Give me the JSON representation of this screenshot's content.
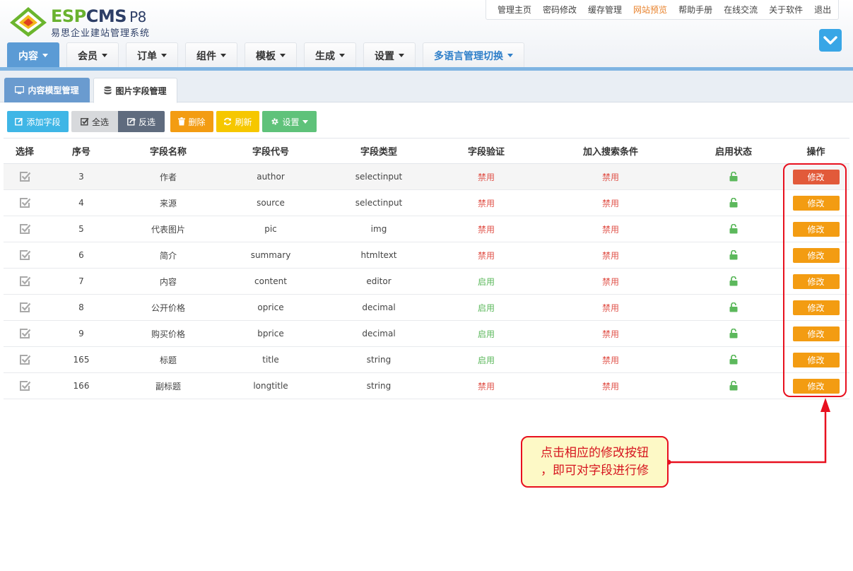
{
  "logo": {
    "brand_part1": "ESP",
    "brand_part2": "CMS",
    "version": "P8",
    "subtitle": "易思企业建站管理系统"
  },
  "toplinks": [
    "管理主页",
    "密码修改",
    "缓存管理",
    "网站预览",
    "帮助手册",
    "在线交流",
    "关于软件",
    "退出"
  ],
  "nav": [
    {
      "label": "内容",
      "active": true
    },
    {
      "label": "会员"
    },
    {
      "label": "订单"
    },
    {
      "label": "组件"
    },
    {
      "label": "模板"
    },
    {
      "label": "生成"
    },
    {
      "label": "设置"
    },
    {
      "label": "多语言管理切换"
    }
  ],
  "subtabs": {
    "model": "内容模型管理",
    "field": "图片字段管理"
  },
  "toolbar": {
    "add": "添加字段",
    "select_all": "全选",
    "invert": "反选",
    "delete": "删除",
    "refresh": "刷新",
    "settings": "设置"
  },
  "table": {
    "headers": [
      "选择",
      "序号",
      "字段名称",
      "字段代号",
      "字段类型",
      "字段验证",
      "加入搜索条件",
      "启用状态",
      "操作"
    ],
    "rows": [
      {
        "id": "3",
        "name": "作者",
        "code": "author",
        "type": "selectinput",
        "validate": "禁用",
        "search": "禁用",
        "action": "修改"
      },
      {
        "id": "4",
        "name": "来源",
        "code": "source",
        "type": "selectinput",
        "validate": "禁用",
        "search": "禁用",
        "action": "修改"
      },
      {
        "id": "5",
        "name": "代表图片",
        "code": "pic",
        "type": "img",
        "validate": "禁用",
        "search": "禁用",
        "action": "修改"
      },
      {
        "id": "6",
        "name": "简介",
        "code": "summary",
        "type": "htmltext",
        "validate": "禁用",
        "search": "禁用",
        "action": "修改"
      },
      {
        "id": "7",
        "name": "内容",
        "code": "content",
        "type": "editor",
        "validate": "启用",
        "search": "禁用",
        "action": "修改"
      },
      {
        "id": "8",
        "name": "公开价格",
        "code": "oprice",
        "type": "decimal",
        "validate": "启用",
        "search": "禁用",
        "action": "修改"
      },
      {
        "id": "9",
        "name": "购买价格",
        "code": "bprice",
        "type": "decimal",
        "validate": "启用",
        "search": "禁用",
        "action": "修改"
      },
      {
        "id": "165",
        "name": "标题",
        "code": "title",
        "type": "string",
        "validate": "启用",
        "search": "禁用",
        "action": "修改"
      },
      {
        "id": "166",
        "name": "副标题",
        "code": "longtitle",
        "type": "string",
        "validate": "禁用",
        "search": "禁用",
        "action": "修改"
      }
    ]
  },
  "callout": {
    "line1": "点击相应的修改按钮",
    "line2": "，即可对字段进行修"
  },
  "colors": {
    "accent": "#5b9bd5",
    "disabled": "#e0534a",
    "enabled": "#5cb85c",
    "edit": "#f39c12",
    "annotation": "#e8101f"
  }
}
